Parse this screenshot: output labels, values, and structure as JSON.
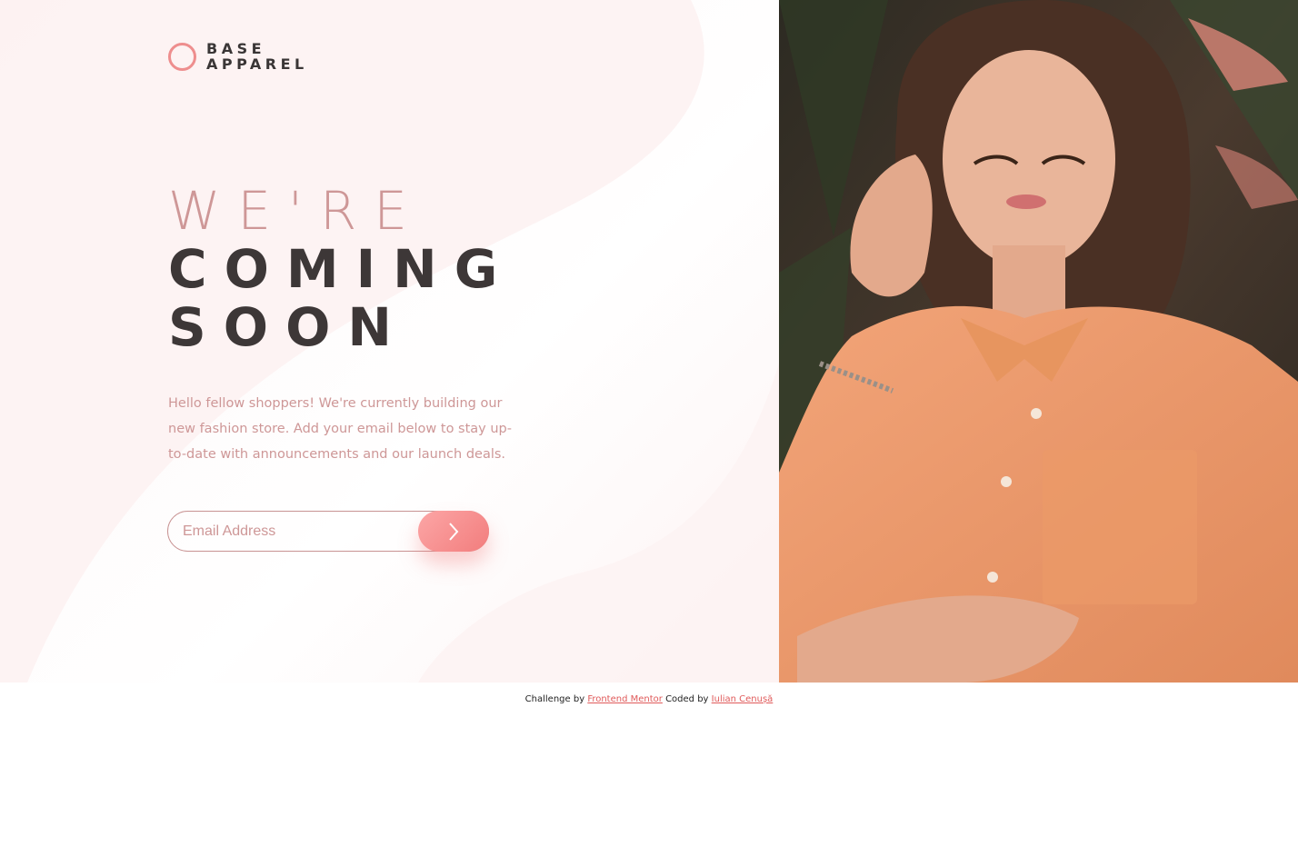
{
  "brand": {
    "line1": "BASE",
    "line2": "APPAREL",
    "accent": "#ee8e8e"
  },
  "headline": {
    "light": "WE'RE",
    "bold_line1": "COMING",
    "bold_line2": "SOON"
  },
  "intro": "Hello fellow shoppers! We're currently building our new fashion store. Add your email below to stay up-to-date with announcements and our launch deals.",
  "signup": {
    "placeholder": "Email Address",
    "submit_icon": "chevron-right-icon"
  },
  "hero_image": {
    "icon": "model-photo"
  },
  "footer": {
    "challenge_prefix": "Challenge by",
    "challenge_link": "Frontend Mentor",
    "coded_prefix": "Coded by",
    "coded_link": "Iulian Cenușă"
  },
  "colors": {
    "text_dark": "#3d3737",
    "text_pink": "#ce9797",
    "button_start": "#fca6a6",
    "button_end": "#f27d7d"
  }
}
